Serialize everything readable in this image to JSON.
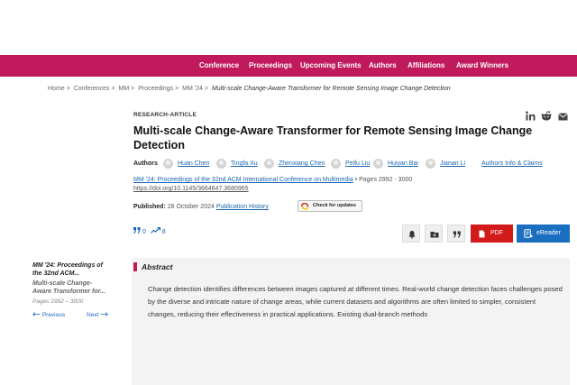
{
  "nav": {
    "items": [
      "Conference",
      "Proceedings",
      "Upcoming Events",
      "Authors",
      "Affiliations",
      "Award Winners"
    ]
  },
  "breadcrumb": {
    "items": [
      "Home",
      "Conferences",
      "MM",
      "Proceedings",
      "MM '24"
    ],
    "separator": ">",
    "current": "Multi-scale Change-Aware Transformer for Remote Sensing Image Change Detection"
  },
  "article": {
    "type": "RESEARCH-ARTICLE",
    "title": "Multi-scale Change-Aware Transformer for Remote Sensing Image Change Detection",
    "authors_label": "Authors",
    "authors": [
      "Huan Chen",
      "Tingfa Xu",
      "Zhenxiang Chen",
      "Peifu Liu",
      "Huiyan Bai",
      "Jianan Li"
    ],
    "authors_info": "Authors Info & Claims",
    "venue": "MM '24: Proceedings of the 32nd ACM International Conference on Multimedia",
    "pages": "• Pages 2992 - 3000",
    "doi": "https://doi.org/10.1145/3664647.3680965",
    "published_label": "Published:",
    "published_date": "28 October 2024",
    "publication_history": "Publication History",
    "check_updates": "Check for updates"
  },
  "metrics": {
    "citations": "0",
    "downloads": "8"
  },
  "buttons": {
    "pdf": "PDF",
    "ereader": "eReader"
  },
  "icons": [
    "linkedin-icon",
    "reddit-icon",
    "email-icon",
    "bell-icon",
    "folder-add-icon",
    "quote-icon",
    "pdf-icon",
    "ereader-icon",
    "citation-icon",
    "trend-icon"
  ],
  "sidebar": {
    "venue": "MM '24: Proceedings of the 32nd ACM...",
    "title": "Multi-scale Change-Aware Transformer for...",
    "pages": "Pages 2992 – 3000",
    "previous": "Previous",
    "next": "Next"
  },
  "abstract": {
    "heading": "Abstract",
    "text": "Change detection identifies differences between images captured at different times. Real-world change detection faces challenges posed by the diverse and intricate nature of change areas, while current datasets and algorithms are often limited to simpler, consistent changes, reducing their effectiveness in practical applications. Existing dual-branch methods"
  },
  "colors": {
    "brand": "#c0195c",
    "link": "#1a66b3",
    "pdf": "#d31a1a",
    "ereader": "#1a6fc0"
  }
}
